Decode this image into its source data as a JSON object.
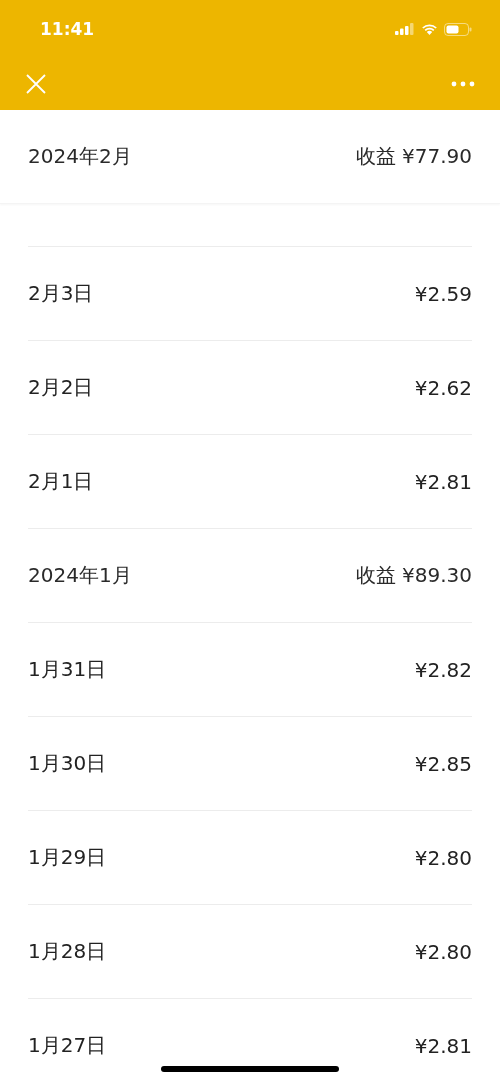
{
  "status_bar": {
    "time": "11:41"
  },
  "sections": [
    {
      "month": "2024年2月",
      "total": "收益 ¥77.90",
      "partial_row_above": true,
      "days": [
        {
          "date": "2月3日",
          "amount": "¥2.59"
        },
        {
          "date": "2月2日",
          "amount": "¥2.62"
        },
        {
          "date": "2月1日",
          "amount": "¥2.81"
        }
      ]
    },
    {
      "month": "2024年1月",
      "total": "收益 ¥89.30",
      "partial_row_above": false,
      "days": [
        {
          "date": "1月31日",
          "amount": "¥2.82"
        },
        {
          "date": "1月30日",
          "amount": "¥2.85"
        },
        {
          "date": "1月29日",
          "amount": "¥2.80"
        },
        {
          "date": "1月28日",
          "amount": "¥2.80"
        },
        {
          "date": "1月27日",
          "amount": "¥2.81"
        }
      ]
    }
  ]
}
